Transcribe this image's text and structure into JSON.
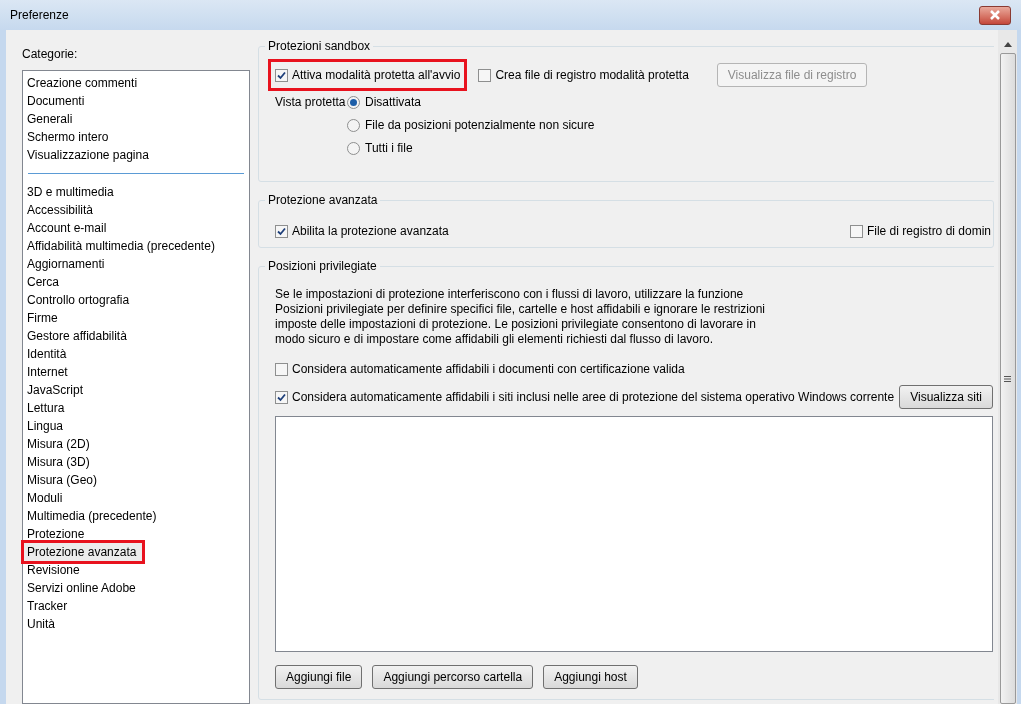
{
  "window": {
    "title": "Preferenze"
  },
  "sidebar": {
    "label": "Categorie:",
    "groups": [
      [
        {
          "label": "Creazione commenti",
          "selected": false,
          "highlighted": false
        },
        {
          "label": "Documenti",
          "selected": false,
          "highlighted": false
        },
        {
          "label": "Generali",
          "selected": false,
          "highlighted": false
        },
        {
          "label": "Schermo intero",
          "selected": false,
          "highlighted": false
        },
        {
          "label": "Visualizzazione pagina",
          "selected": false,
          "highlighted": false
        }
      ],
      [
        {
          "label": "3D e multimedia",
          "selected": false,
          "highlighted": false
        },
        {
          "label": "Accessibilità",
          "selected": false,
          "highlighted": false
        },
        {
          "label": "Account e-mail",
          "selected": false,
          "highlighted": false
        },
        {
          "label": "Affidabilità multimedia (precedente)",
          "selected": false,
          "highlighted": false
        },
        {
          "label": "Aggiornamenti",
          "selected": false,
          "highlighted": false
        },
        {
          "label": "Cerca",
          "selected": false,
          "highlighted": false
        },
        {
          "label": "Controllo ortografia",
          "selected": false,
          "highlighted": false
        },
        {
          "label": "Firme",
          "selected": false,
          "highlighted": false
        },
        {
          "label": "Gestore affidabilità",
          "selected": false,
          "highlighted": false
        },
        {
          "label": "Identità",
          "selected": false,
          "highlighted": false
        },
        {
          "label": "Internet",
          "selected": false,
          "highlighted": false
        },
        {
          "label": "JavaScript",
          "selected": false,
          "highlighted": false
        },
        {
          "label": "Lettura",
          "selected": false,
          "highlighted": false
        },
        {
          "label": "Lingua",
          "selected": false,
          "highlighted": false
        },
        {
          "label": "Misura (2D)",
          "selected": false,
          "highlighted": false
        },
        {
          "label": "Misura (3D)",
          "selected": false,
          "highlighted": false
        },
        {
          "label": "Misura (Geo)",
          "selected": false,
          "highlighted": false
        },
        {
          "label": "Moduli",
          "selected": false,
          "highlighted": false
        },
        {
          "label": "Multimedia (precedente)",
          "selected": false,
          "highlighted": false
        },
        {
          "label": "Protezione",
          "selected": false,
          "highlighted": false
        },
        {
          "label": "Protezione avanzata",
          "selected": true,
          "highlighted": true
        },
        {
          "label": "Revisione",
          "selected": false,
          "highlighted": false
        },
        {
          "label": "Servizi online Adobe",
          "selected": false,
          "highlighted": false
        },
        {
          "label": "Tracker",
          "selected": false,
          "highlighted": false
        },
        {
          "label": "Unità",
          "selected": false,
          "highlighted": false
        }
      ]
    ]
  },
  "sandbox": {
    "title": "Protezioni sandbox",
    "checkboxes": [
      {
        "label": "Attiva modalità protetta all'avvio",
        "checked": true,
        "highlighted": true
      },
      {
        "label": "Crea file di registro modalità protetta",
        "checked": false,
        "highlighted": false
      }
    ],
    "log_button": {
      "label": "Visualizza file di registro",
      "disabled": true
    },
    "view_label": "Vista protetta",
    "radios": [
      {
        "label": "Disattivata",
        "selected": true
      },
      {
        "label": "File da posizioni potenzialmente non sicure",
        "selected": false
      },
      {
        "label": "Tutti i file",
        "selected": false
      }
    ]
  },
  "advanced": {
    "title": "Protezione avanzata",
    "checkboxes": [
      {
        "label": "Abilita la protezione avanzata",
        "checked": true
      },
      {
        "label": "File di registro di domin",
        "checked": false
      }
    ]
  },
  "privileged": {
    "title": "Posizioni privilegiate",
    "description": "Se le impostazioni di protezione interferiscono con i flussi di lavoro, utilizzare la funzione Posizioni privilegiate per definire specifici file, cartelle e host affidabili e ignorare le restrizioni imposte delle impostazioni di protezione. Le posizioni privilegiate consentono di lavorare in modo sicuro e di impostare come affidabili gli elementi richiesti dal flusso di lavoro.",
    "checkboxes": [
      {
        "label": "Considera automaticamente affidabili i documenti con certificazione valida",
        "checked": false
      },
      {
        "label": "Considera automaticamente affidabili i siti inclusi nelle aree di protezione del sistema operativo Windows corrente",
        "checked": true
      }
    ],
    "sites_button": "Visualizza siti",
    "buttons": [
      "Aggiungi file",
      "Aggiungi percorso cartella",
      "Aggiungi host"
    ]
  }
}
